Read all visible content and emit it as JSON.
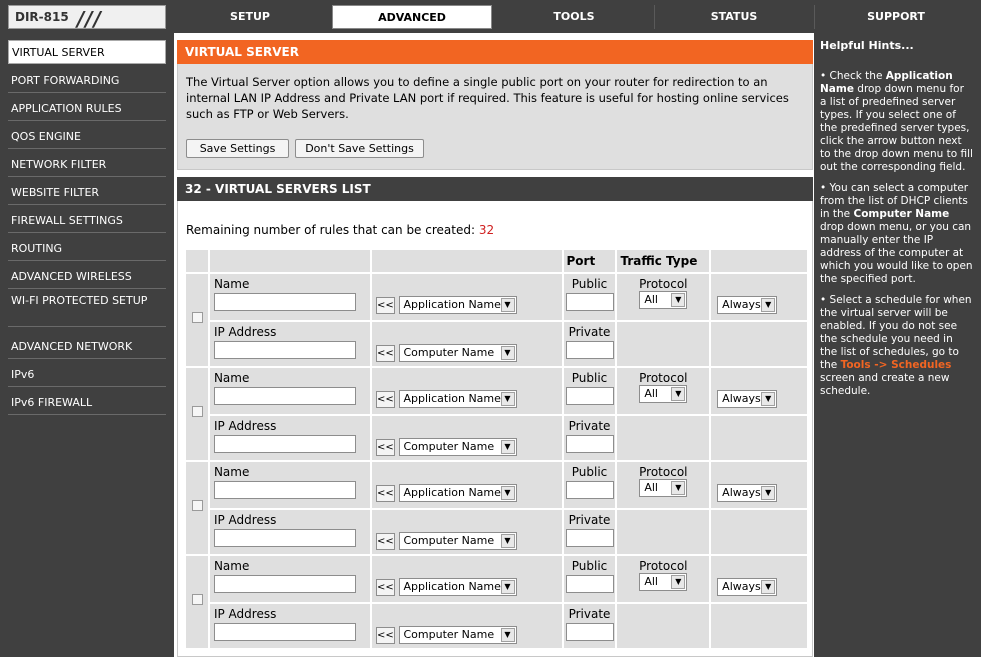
{
  "header": {
    "model": "DIR-815",
    "tabs": [
      "SETUP",
      "ADVANCED",
      "TOOLS",
      "STATUS",
      "SUPPORT"
    ],
    "active_tab": "ADVANCED"
  },
  "sidebar": {
    "items": [
      "VIRTUAL SERVER",
      "PORT FORWARDING",
      "APPLICATION RULES",
      "QOS ENGINE",
      "NETWORK FILTER",
      "WEBSITE FILTER",
      "FIREWALL SETTINGS",
      "ROUTING",
      "ADVANCED WIRELESS",
      "WI-FI PROTECTED SETUP",
      "ADVANCED NETWORK",
      "IPv6",
      "IPv6 FIREWALL"
    ],
    "active": "VIRTUAL SERVER"
  },
  "main": {
    "section_title": "VIRTUAL SERVER",
    "intro": "The Virtual Server option allows you to define a single public port on your router for redirection to an internal LAN IP Address and Private LAN port if required. This feature is useful for hosting online services such as FTP or Web Servers.",
    "save_label": "Save Settings",
    "dont_save_label": "Don't Save Settings",
    "list_title": "32 - VIRTUAL SERVERS LIST",
    "remaining_label": "Remaining number of rules that can be created:",
    "remaining_count": "32",
    "table_headers": {
      "port": "Port",
      "traffic_type": "Traffic Type"
    },
    "row_labels": {
      "name": "Name",
      "ip_address": "IP Address",
      "public": "Public",
      "private": "Private",
      "protocol": "Protocol",
      "arrow": "<<",
      "application_name": "Application Name",
      "computer_name": "Computer Name",
      "protocol_value": "All",
      "schedule_value": "Always"
    }
  },
  "hints": {
    "title": "Helpful Hints...",
    "items": [
      {
        "pre": "Check the ",
        "bold": "Application Name",
        "post": " drop down menu for a list of predefined server types. If you select one of the predefined server types, click the arrow button next to the drop down menu to fill out the corresponding field."
      },
      {
        "pre": "You can select a computer from the list of DHCP clients in the ",
        "bold": "Computer Name",
        "post": " drop down menu, or you can manually enter the IP address of the computer at which you would like to open the specified port."
      },
      {
        "pre": "Select a schedule for when the virtual server will be enabled. If you do not see the schedule you need in the list of schedules, go to the ",
        "bold": "Tools -> Schedules",
        "post": " screen and create a new schedule."
      }
    ]
  },
  "colors": {
    "accent": "#f26522",
    "dark": "#404040",
    "panel": "#dfdfdf",
    "count_red": "#d02020"
  }
}
